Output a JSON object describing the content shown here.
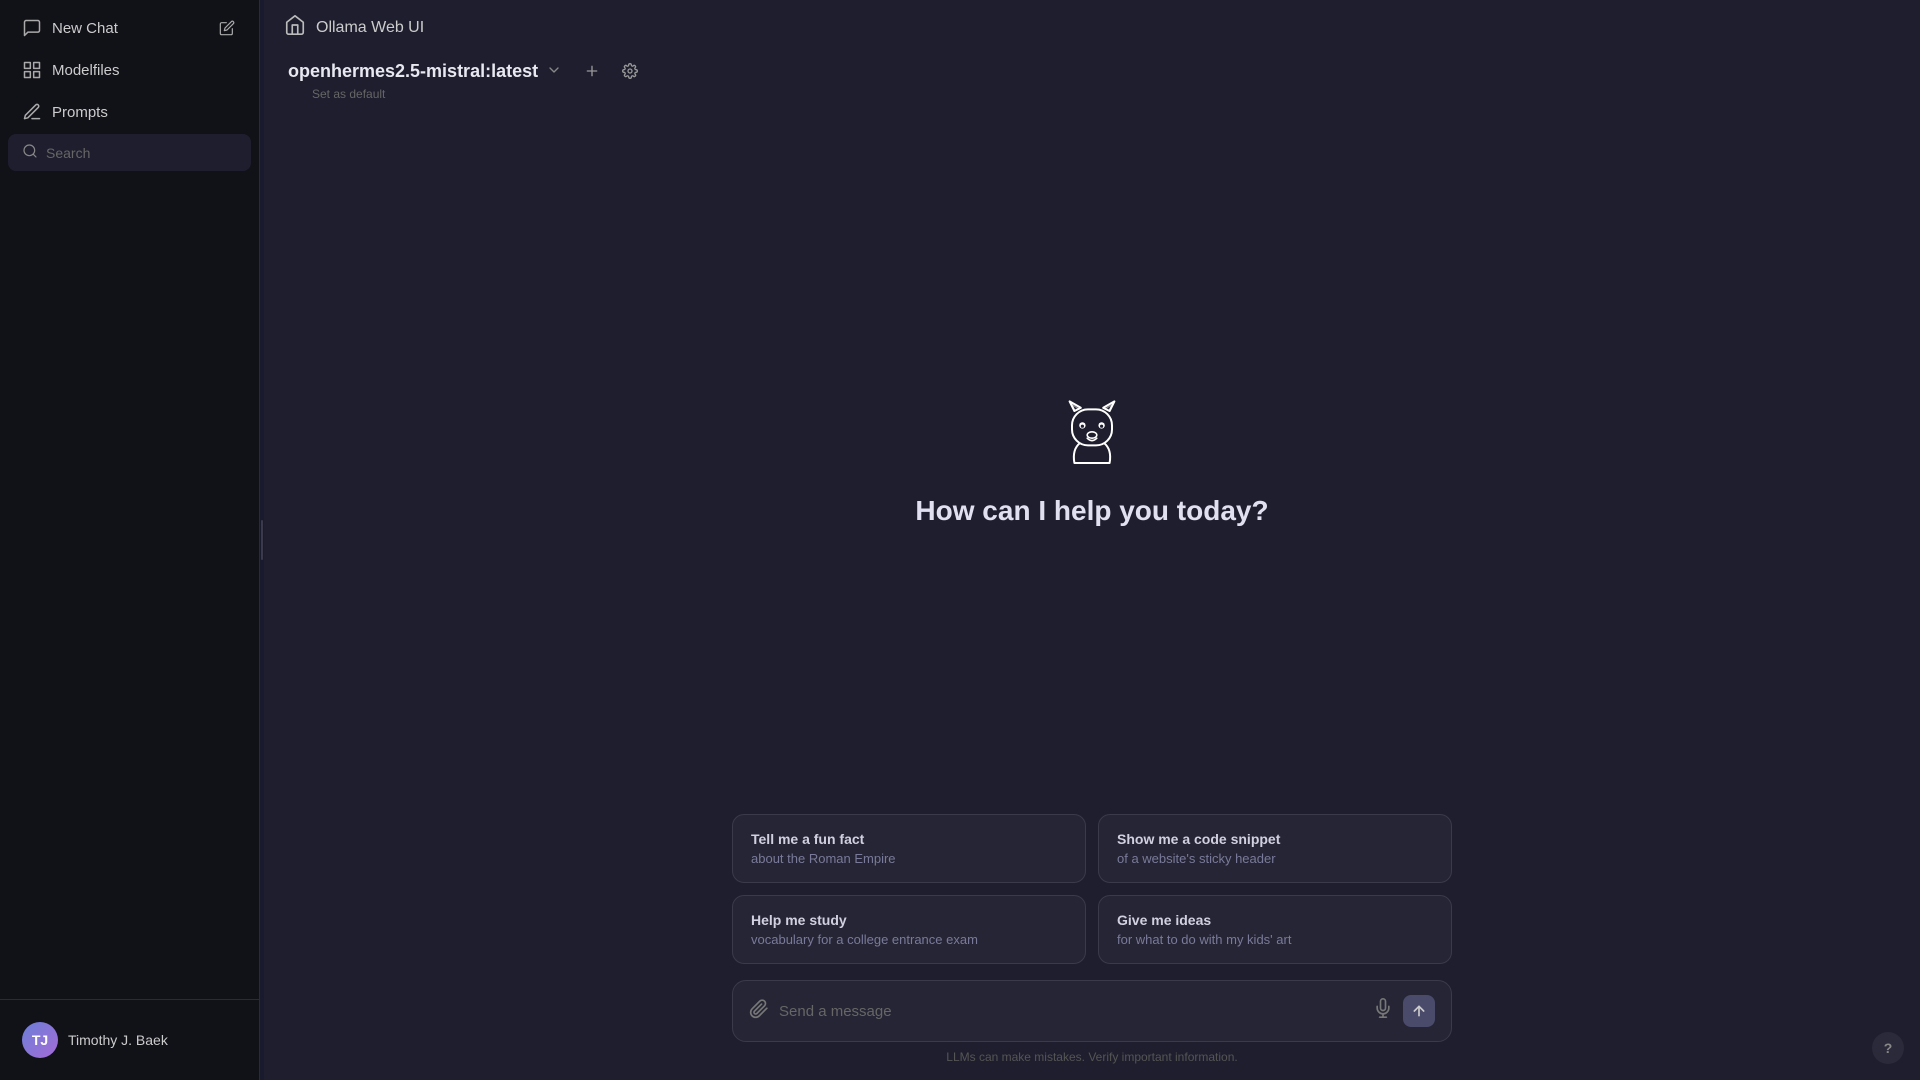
{
  "sidebar": {
    "new_chat_label": "New Chat",
    "modelfiles_label": "Modelfiles",
    "prompts_label": "Prompts",
    "search_placeholder": "Search",
    "items": [
      {
        "id": "new-chat",
        "label": "New Chat",
        "icon": "✏"
      },
      {
        "id": "modelfiles",
        "label": "Modelfiles",
        "icon": "⊞"
      },
      {
        "id": "prompts",
        "label": "Prompts",
        "icon": "✎"
      }
    ]
  },
  "user": {
    "name": "Timothy J. Baek",
    "initials": "TJ"
  },
  "header": {
    "app_name": "Ollama Web UI",
    "app_icon": "🦙"
  },
  "model": {
    "name": "openhermes2.5-mistral:latest",
    "set_default_label": "Set as default"
  },
  "welcome": {
    "text": "How can I help you today?"
  },
  "suggestions": [
    {
      "title": "Tell me a fun fact",
      "subtitle": "about the Roman Empire"
    },
    {
      "title": "Show me a code snippet",
      "subtitle": "of a website's sticky header"
    },
    {
      "title": "Help me study",
      "subtitle": "vocabulary for a college entrance exam"
    },
    {
      "title": "Give me ideas",
      "subtitle": "for what to do with my kids' art"
    }
  ],
  "input": {
    "placeholder": "Send a message"
  },
  "disclaimer": {
    "text": "LLMs can make mistakes. Verify important information."
  }
}
